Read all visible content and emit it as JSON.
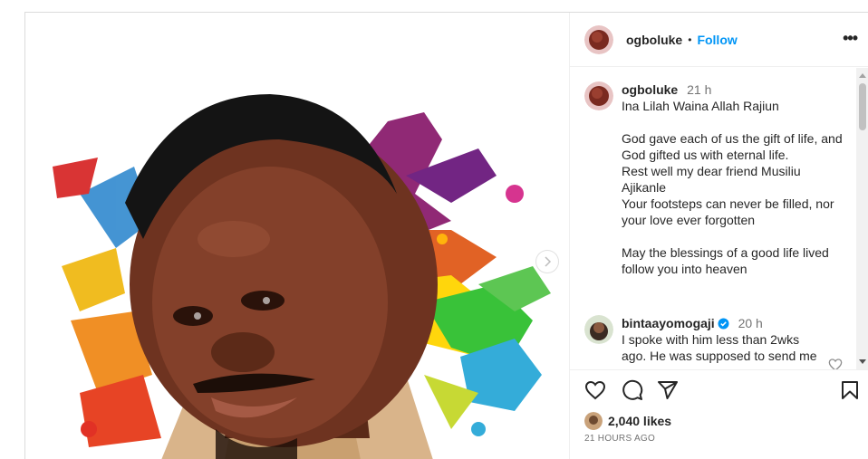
{
  "post": {
    "username": "ogboluke",
    "dot": "•",
    "follow_label": "Follow",
    "more_label": "•••",
    "likes": "2,040 likes",
    "posted_ago": "21 HOURS AGO"
  },
  "caption": {
    "username": "ogboluke",
    "time": "21 h",
    "lines": [
      "Ina Lilah Waina Allah Rajiun",
      "",
      "God gave each of us the gift of life, and",
      "God gifted us with eternal life.",
      "Rest well my dear friend Musiliu",
      "Ajikanle",
      "Your footsteps can never be filled, nor",
      "your love ever forgotten",
      "",
      "May the blessings of a good life lived",
      "follow you into heaven"
    ]
  },
  "comment": {
    "username": "bintaayomogaji",
    "time": "20 h",
    "lines": [
      "I spoke with him less than 2wks",
      "ago. He was supposed to send me"
    ]
  },
  "icons": {
    "like": "heart-icon",
    "comment": "comment-icon",
    "share": "share-icon",
    "save": "bookmark-icon",
    "next": "chevron-right-icon",
    "verified": "verified-badge-icon"
  },
  "colors": {
    "accent": "#0095f6",
    "verified": "#0095f6",
    "text": "#262626",
    "muted": "#737373"
  }
}
